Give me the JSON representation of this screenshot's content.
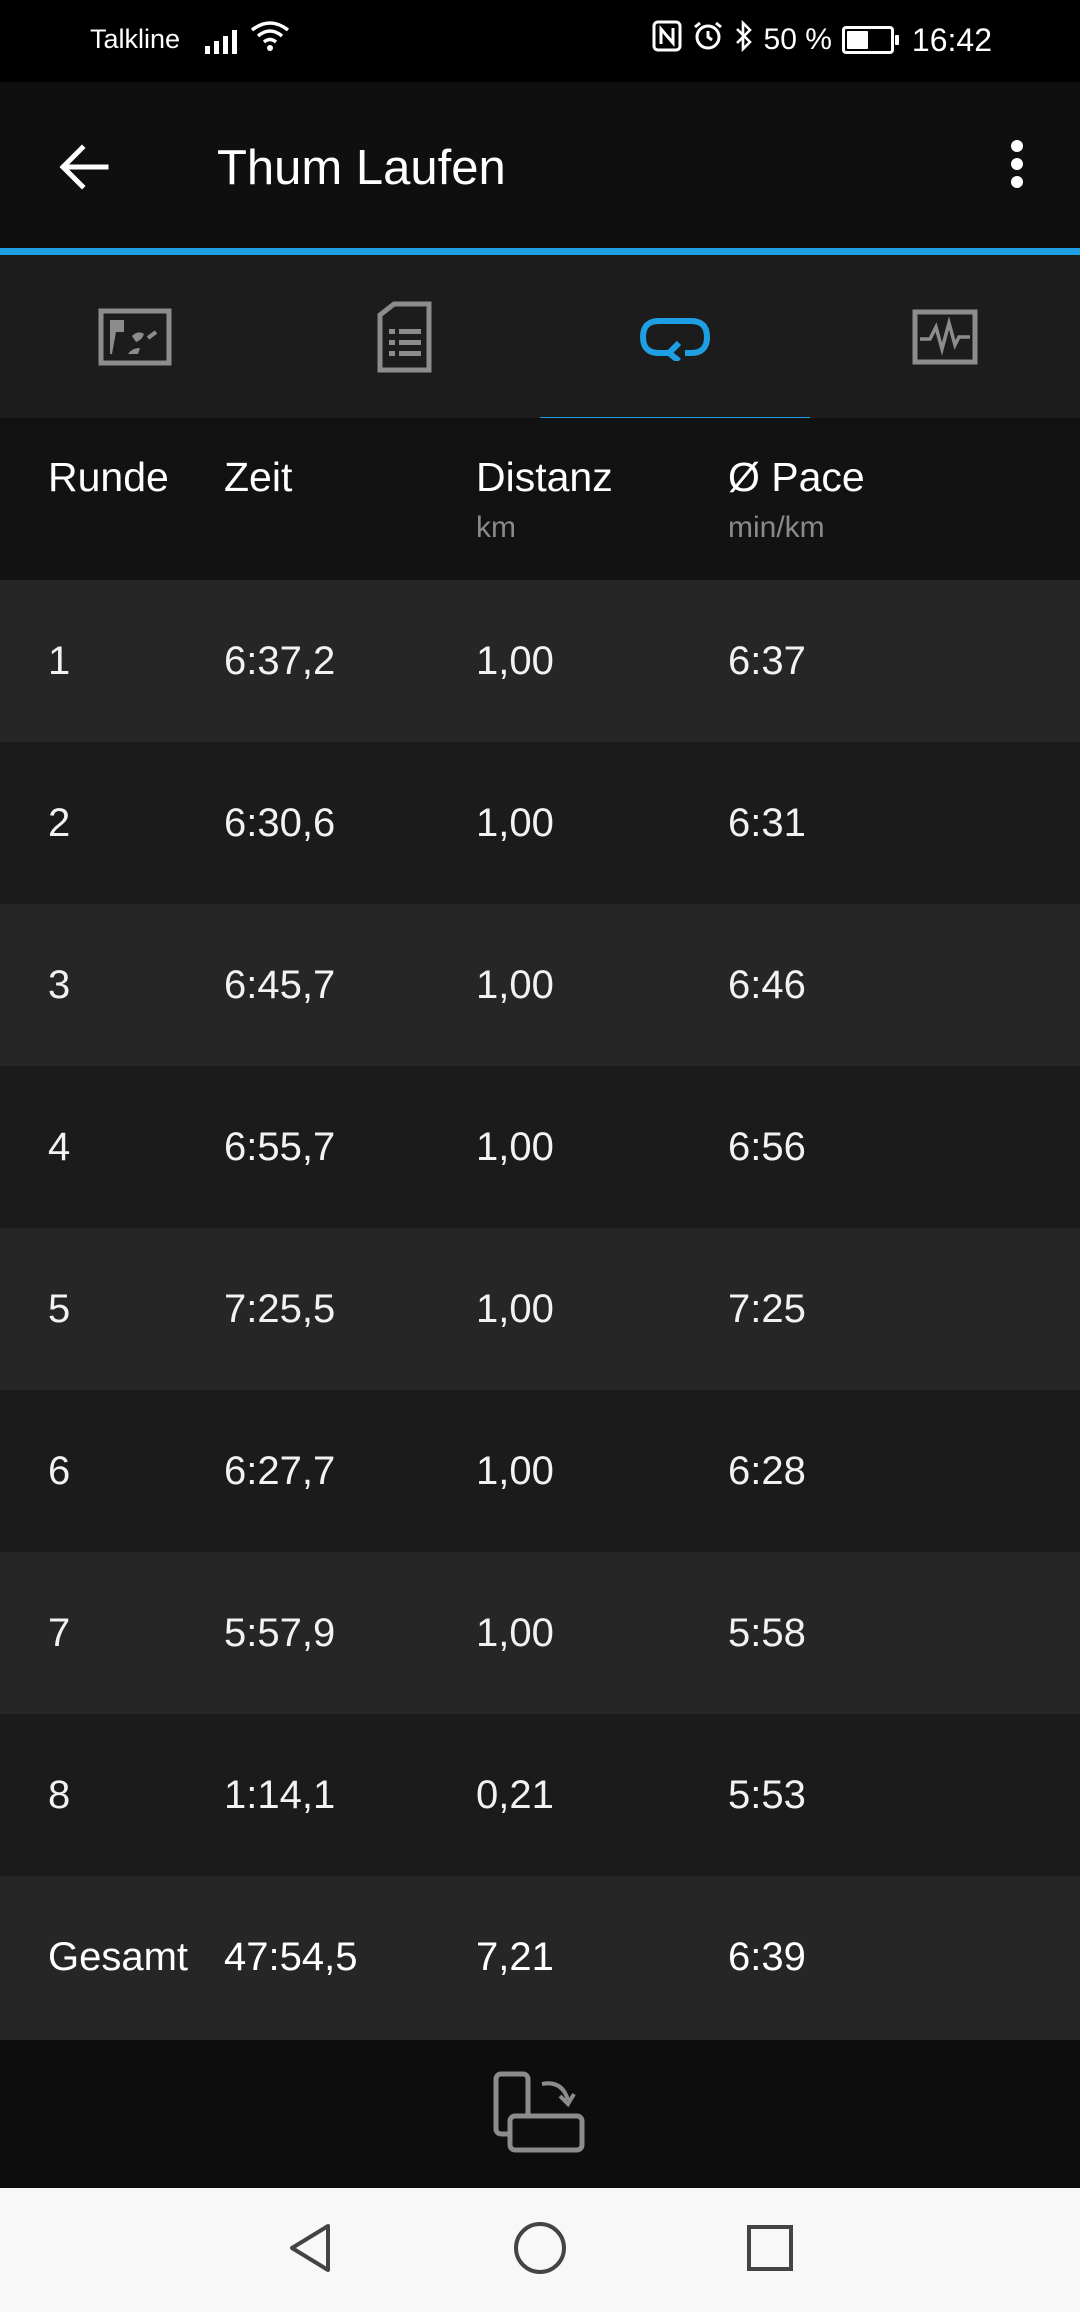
{
  "status_bar": {
    "carrier": "Talkline",
    "battery_percent": "50 %",
    "battery_level": 0.5,
    "time": "16:42"
  },
  "app_bar": {
    "title": "Thum Laufen"
  },
  "tabs": [
    {
      "name": "map",
      "icon": "map-icon",
      "active": false
    },
    {
      "name": "details",
      "icon": "document-icon",
      "active": false
    },
    {
      "name": "laps",
      "icon": "laps-loop-icon",
      "active": true
    },
    {
      "name": "charts",
      "icon": "chart-icon",
      "active": false
    }
  ],
  "table": {
    "headers": [
      {
        "label": "Runde",
        "unit": ""
      },
      {
        "label": "Zeit",
        "unit": ""
      },
      {
        "label": "Distanz",
        "unit": "km"
      },
      {
        "label": "Ø Pace",
        "unit": "min/km"
      }
    ],
    "rows": [
      [
        "1",
        "6:37,2",
        "1,00",
        "6:37"
      ],
      [
        "2",
        "6:30,6",
        "1,00",
        "6:31"
      ],
      [
        "3",
        "6:45,7",
        "1,00",
        "6:46"
      ],
      [
        "4",
        "6:55,7",
        "1,00",
        "6:56"
      ],
      [
        "5",
        "7:25,5",
        "1,00",
        "7:25"
      ],
      [
        "6",
        "6:27,7",
        "1,00",
        "6:28"
      ],
      [
        "7",
        "5:57,9",
        "1,00",
        "5:58"
      ],
      [
        "8",
        "1:14,1",
        "0,21",
        "5:53"
      ]
    ],
    "total": [
      "Gesamt",
      "47:54,5",
      "7,21",
      "6:39"
    ]
  },
  "colors": {
    "accent": "#1e9fe3",
    "row_light": "#262626",
    "row_dark": "#1b1b1b"
  }
}
